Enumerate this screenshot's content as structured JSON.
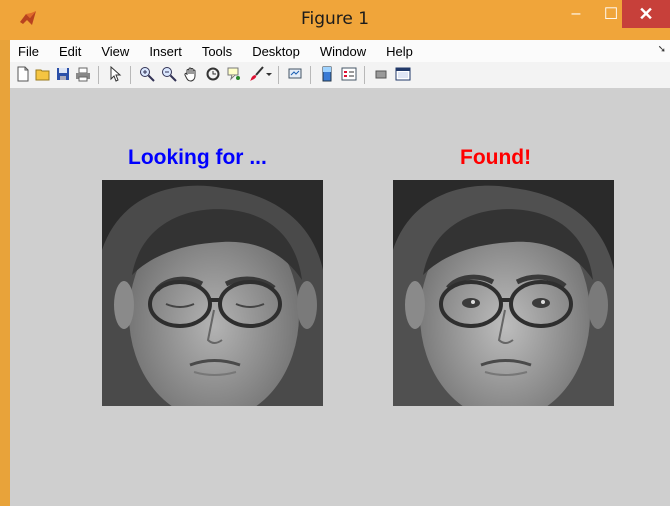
{
  "window": {
    "title": "Figure 1",
    "controls": {
      "minimize": "‒",
      "maximize": "☐",
      "close": "✕"
    }
  },
  "menu": [
    "File",
    "Edit",
    "View",
    "Insert",
    "Tools",
    "Desktop",
    "Window",
    "Help"
  ],
  "toolbar": [
    "new-figure",
    "open-file",
    "save",
    "print",
    "edit-plot",
    "zoom-in",
    "zoom-out",
    "pan",
    "rotate-3d",
    "data-cursor",
    "brush",
    "link-plot",
    "insert-colorbar",
    "insert-legend",
    "hide-plot-tools",
    "show-plot-tools"
  ],
  "axes": {
    "left": {
      "title": "Looking for ..."
    },
    "right": {
      "title": "Found!"
    }
  },
  "colors": {
    "left_title": "#0000ff",
    "right_title": "#ff0000",
    "background": "#cfcfcf",
    "titlebar": "#f0a53a"
  }
}
